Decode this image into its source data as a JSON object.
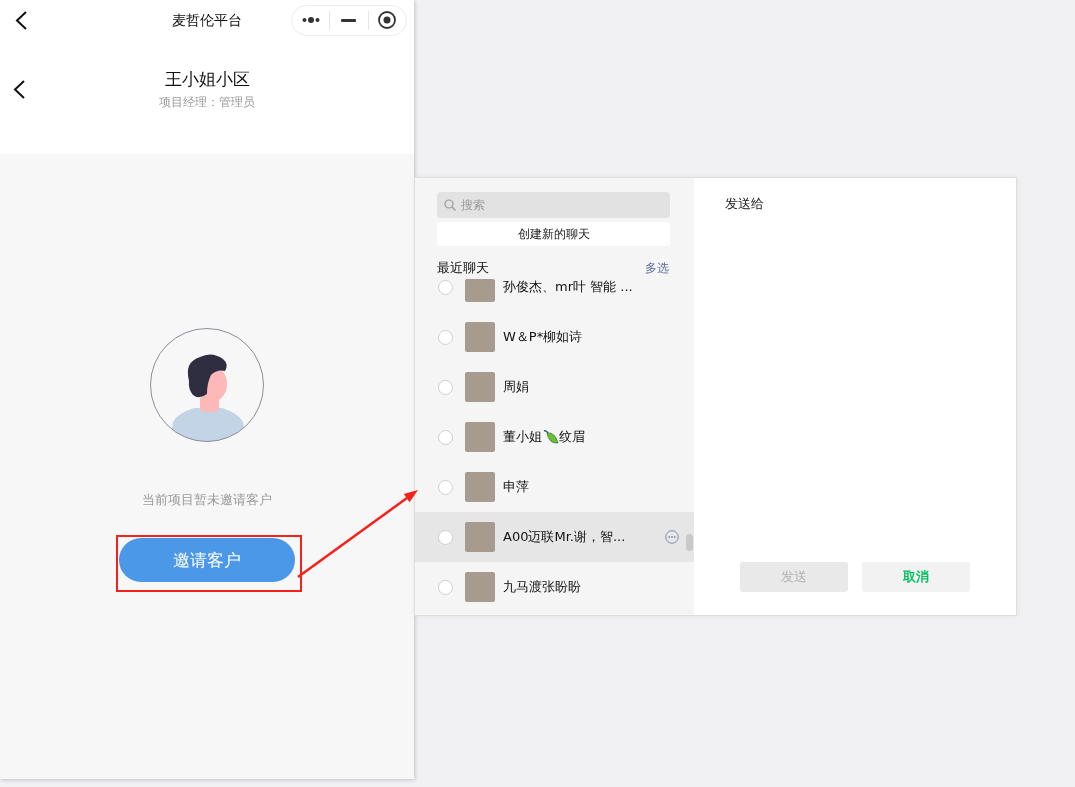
{
  "top_bar": {
    "title": "麦哲伦平台"
  },
  "header": {
    "title": "王小姐小区",
    "subtitle": "项目经理：管理员"
  },
  "empty_state": {
    "message": "当前项目暂未邀请客户",
    "button": "邀请客户"
  },
  "share_dialog": {
    "search": {
      "placeholder": "搜索"
    },
    "create_chat": "创建新的聊天",
    "section_title": "最近聊天",
    "multi_select": "多选",
    "chats": [
      {
        "name": "孙俊杰、mr叶 智能 ...",
        "checked": false,
        "hovered": false,
        "clipped_top": true
      },
      {
        "name": "W＆P*柳如诗",
        "checked": false,
        "hovered": false,
        "clipped_top": false
      },
      {
        "name": "周娟",
        "checked": false,
        "hovered": false,
        "clipped_top": false
      },
      {
        "name": "董小姐",
        "name_after_icon": "纹眉",
        "checked": false,
        "hovered": false,
        "clipped_top": false
      },
      {
        "name": "申萍",
        "checked": false,
        "hovered": false,
        "clipped_top": false
      },
      {
        "name": "A00迈联Mr.谢，智...",
        "checked": false,
        "hovered": true,
        "clipped_top": false
      },
      {
        "name": "九马渡张盼盼",
        "checked": false,
        "hovered": false,
        "clipped_top": false
      }
    ],
    "send_to": "发送给",
    "buttons": [
      {
        "label": "发送",
        "kind": "send",
        "disabled": true
      },
      {
        "label": "取消",
        "kind": "cancel",
        "disabled": false
      }
    ]
  }
}
